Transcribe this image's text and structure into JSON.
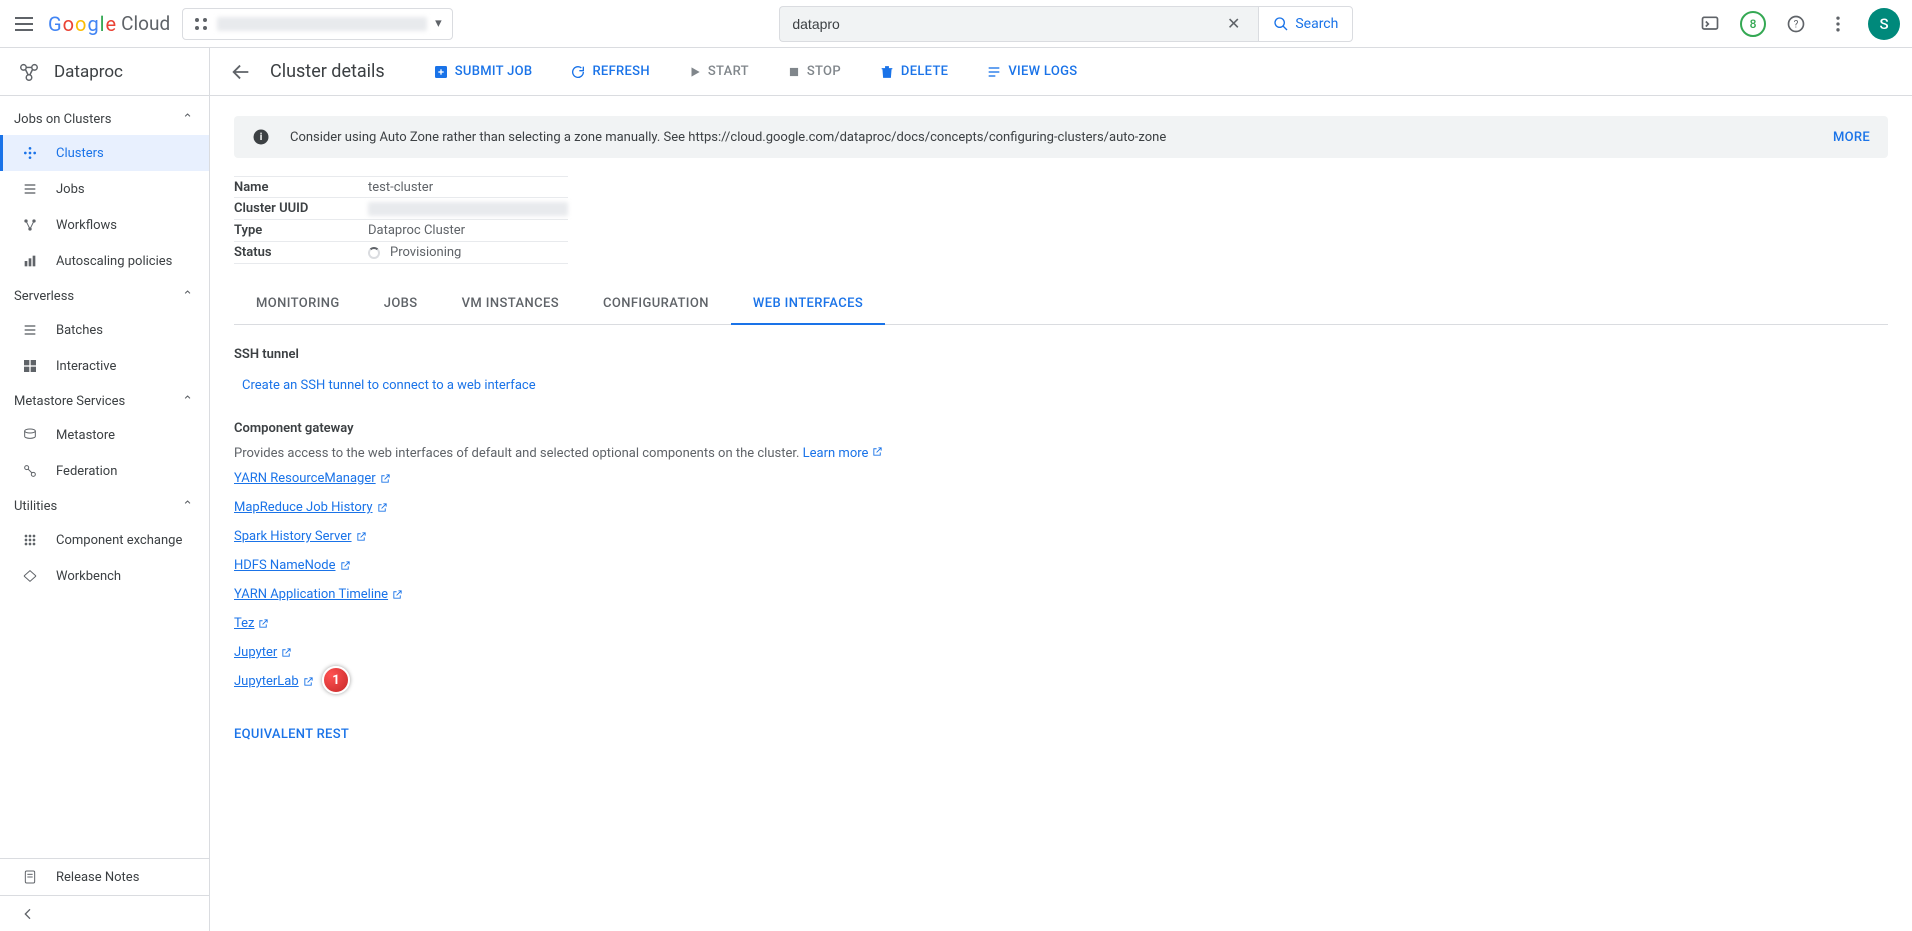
{
  "header": {
    "logo_cloud": "Cloud",
    "search_value": "datapro",
    "search_button": "Search",
    "trial_days": "8",
    "avatar_letter": "S"
  },
  "sidebar": {
    "product": "Dataproc",
    "sections": [
      {
        "title": "Jobs on Clusters",
        "items": [
          "Clusters",
          "Jobs",
          "Workflows",
          "Autoscaling policies"
        ],
        "selected": 0
      },
      {
        "title": "Serverless",
        "items": [
          "Batches",
          "Interactive"
        ]
      },
      {
        "title": "Metastore Services",
        "items": [
          "Metastore",
          "Federation"
        ]
      },
      {
        "title": "Utilities",
        "items": [
          "Component exchange",
          "Workbench"
        ]
      }
    ],
    "footer_item": "Release Notes"
  },
  "page": {
    "title": "Cluster details",
    "actions": [
      {
        "label": "SUBMIT JOB",
        "style": "primary"
      },
      {
        "label": "REFRESH",
        "style": "primary"
      },
      {
        "label": "START",
        "style": "muted"
      },
      {
        "label": "STOP",
        "style": "muted"
      },
      {
        "label": "DELETE",
        "style": "primary"
      },
      {
        "label": "VIEW LOGS",
        "style": "primary"
      }
    ],
    "banner": {
      "text": "Consider using Auto Zone rather than selecting a zone manually. See https://cloud.google.com/dataproc/docs/concepts/configuring-clusters/auto-zone",
      "more": "MORE"
    },
    "meta": {
      "name_key": "Name",
      "name_val": "test-cluster",
      "uuid_key": "Cluster UUID",
      "type_key": "Type",
      "type_val": "Dataproc Cluster",
      "status_key": "Status",
      "status_val": "Provisioning"
    },
    "tabs": [
      "MONITORING",
      "JOBS",
      "VM INSTANCES",
      "CONFIGURATION",
      "WEB INTERFACES"
    ],
    "active_tab": 4,
    "ssh_title": "SSH tunnel",
    "ssh_link": "Create an SSH tunnel to connect to a web interface",
    "gateway_title": "Component gateway",
    "gateway_desc": "Provides access to the web interfaces of default and selected optional components on the cluster.",
    "learn_more": "Learn more",
    "gateway_links": [
      "YARN ResourceManager",
      "MapReduce Job History",
      "Spark History Server",
      "HDFS NameNode",
      "YARN Application Timeline",
      "Tez",
      "Jupyter",
      "JupyterLab"
    ],
    "equiv_rest": "EQUIVALENT REST",
    "annotation_num": "1"
  }
}
